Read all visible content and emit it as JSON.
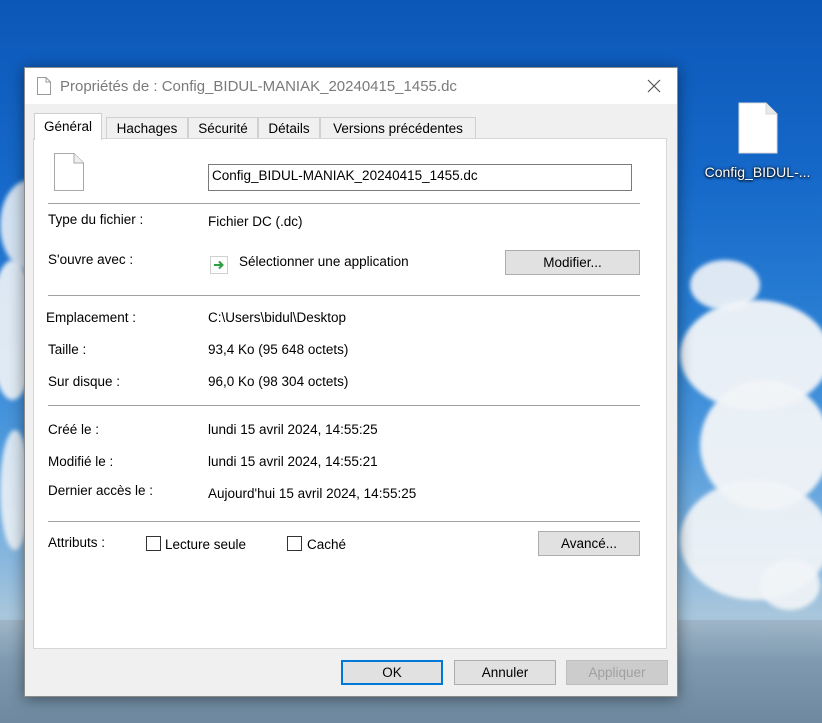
{
  "desktop": {
    "icon_label": "Config_BIDUL-..."
  },
  "window": {
    "title": "Propriétés de : Config_BIDUL-MANIAK_20240415_1455.dc"
  },
  "tabs": [
    {
      "label": "Général"
    },
    {
      "label": "Hachages"
    },
    {
      "label": "Sécurité"
    },
    {
      "label": "Détails"
    },
    {
      "label": "Versions précédentes"
    }
  ],
  "general": {
    "file_name": "Config_BIDUL-MANIAK_20240415_1455.dc",
    "type_label": "Type du fichier :",
    "type_value": "Fichier DC (.dc)",
    "opens_label": "S'ouvre avec :",
    "opens_value": "Sélectionner une application",
    "modify_button": "Modifier...",
    "location_label": "Emplacement :",
    "location_value": "C:\\Users\\bidul\\Desktop",
    "size_label": "Taille :",
    "size_value": "93,4 Ko (95 648 octets)",
    "disk_label": "Sur disque :",
    "disk_value": "96,0 Ko (98 304 octets)",
    "created_label": "Créé le :",
    "created_value": "lundi 15 avril 2024, 14:55:25",
    "modified_label": "Modifié le :",
    "modified_value": "lundi 15 avril 2024, 14:55:21",
    "accessed_label": "Dernier accès le :",
    "accessed_value": "Aujourd'hui 15 avril 2024, 14:55:25",
    "attributes_label": "Attributs :",
    "readonly_label": "Lecture seule",
    "readonly_checked": false,
    "hidden_label": "Caché",
    "hidden_checked": false,
    "advanced_button": "Avancé..."
  },
  "footer": {
    "ok": "OK",
    "cancel": "Annuler",
    "apply": "Appliquer"
  },
  "colors": {
    "accent": "#0078d7",
    "open_with_arrow": "#2ea043"
  }
}
